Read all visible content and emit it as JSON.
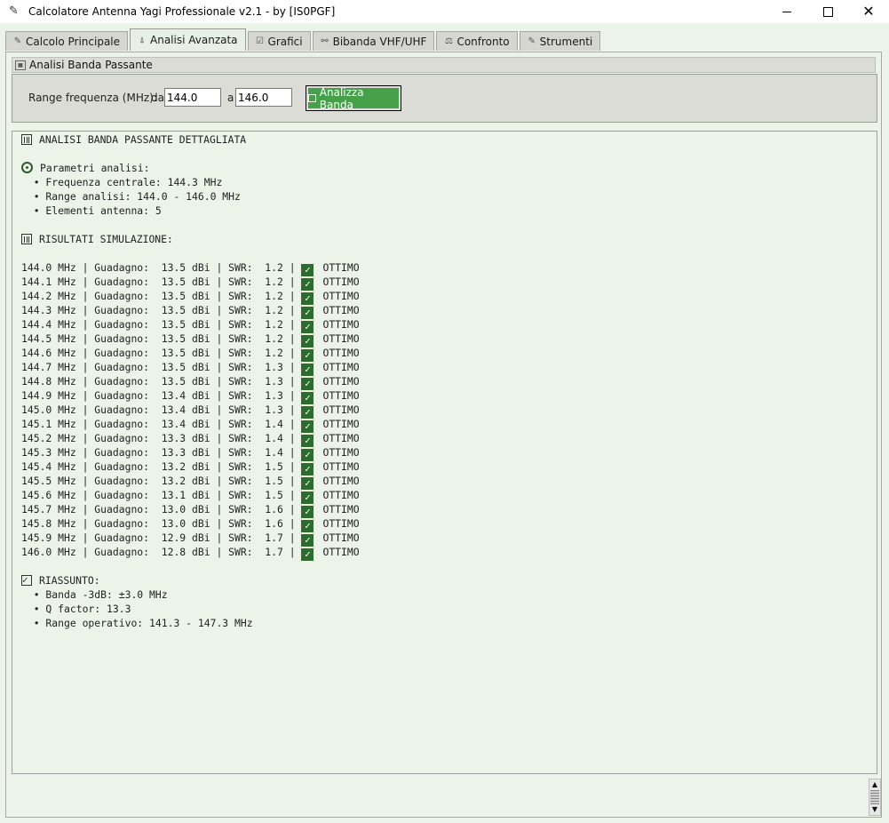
{
  "window": {
    "title": "Calcolatore Antenna Yagi Professionale v2.1 - by [IS0PGF]",
    "minimize_glyph": "",
    "close_glyph": "✕"
  },
  "tabs": [
    {
      "label": "Calcolo Principale",
      "icon": "pencil-icon",
      "active": false
    },
    {
      "label": "Analisi Avanzata",
      "icon": "antenna-icon",
      "active": true
    },
    {
      "label": "Grafici",
      "icon": "checkbox-chart-icon",
      "active": false
    },
    {
      "label": "Bibanda VHF/UHF",
      "icon": "satellite-icon",
      "active": false
    },
    {
      "label": "Confronto",
      "icon": "scales-icon",
      "active": false
    },
    {
      "label": "Strumenti",
      "icon": "wrench-icon",
      "active": false
    }
  ],
  "bandpass": {
    "section_title": "Analisi Banda Passante",
    "range_label": "Range frequenza (MHz):",
    "from_label": "da",
    "from_value": "144.0",
    "to_label": "a",
    "to_value": "146.0",
    "analyze_button": "Analizza Banda"
  },
  "report": {
    "heading": "ANALISI BANDA PASSANTE DETTAGLIATA",
    "params_heading": "Parametri analisi:",
    "params": [
      "  • Frequenza centrale: 144.3 MHz",
      "  • Range analisi: 144.0 - 146.0 MHz",
      "  • Elementi antenna: 5"
    ],
    "results_heading": "RISULTATI SIMULAZIONE:",
    "rows": [
      {
        "freq": "144.0",
        "gain": "13.5",
        "swr": "1.2",
        "status": "OTTIMO"
      },
      {
        "freq": "144.1",
        "gain": "13.5",
        "swr": "1.2",
        "status": "OTTIMO"
      },
      {
        "freq": "144.2",
        "gain": "13.5",
        "swr": "1.2",
        "status": "OTTIMO"
      },
      {
        "freq": "144.3",
        "gain": "13.5",
        "swr": "1.2",
        "status": "OTTIMO"
      },
      {
        "freq": "144.4",
        "gain": "13.5",
        "swr": "1.2",
        "status": "OTTIMO"
      },
      {
        "freq": "144.5",
        "gain": "13.5",
        "swr": "1.2",
        "status": "OTTIMO"
      },
      {
        "freq": "144.6",
        "gain": "13.5",
        "swr": "1.2",
        "status": "OTTIMO"
      },
      {
        "freq": "144.7",
        "gain": "13.5",
        "swr": "1.3",
        "status": "OTTIMO"
      },
      {
        "freq": "144.8",
        "gain": "13.5",
        "swr": "1.3",
        "status": "OTTIMO"
      },
      {
        "freq": "144.9",
        "gain": "13.4",
        "swr": "1.3",
        "status": "OTTIMO"
      },
      {
        "freq": "145.0",
        "gain": "13.4",
        "swr": "1.3",
        "status": "OTTIMO"
      },
      {
        "freq": "145.1",
        "gain": "13.4",
        "swr": "1.4",
        "status": "OTTIMO"
      },
      {
        "freq": "145.2",
        "gain": "13.3",
        "swr": "1.4",
        "status": "OTTIMO"
      },
      {
        "freq": "145.3",
        "gain": "13.3",
        "swr": "1.4",
        "status": "OTTIMO"
      },
      {
        "freq": "145.4",
        "gain": "13.2",
        "swr": "1.5",
        "status": "OTTIMO"
      },
      {
        "freq": "145.5",
        "gain": "13.2",
        "swr": "1.5",
        "status": "OTTIMO"
      },
      {
        "freq": "145.6",
        "gain": "13.1",
        "swr": "1.5",
        "status": "OTTIMO"
      },
      {
        "freq": "145.7",
        "gain": "13.0",
        "swr": "1.6",
        "status": "OTTIMO"
      },
      {
        "freq": "145.8",
        "gain": "13.0",
        "swr": "1.6",
        "status": "OTTIMO"
      },
      {
        "freq": "145.9",
        "gain": "12.9",
        "swr": "1.7",
        "status": "OTTIMO"
      },
      {
        "freq": "146.0",
        "gain": "12.8",
        "swr": "1.7",
        "status": "OTTIMO"
      }
    ],
    "row_labels": {
      "unit": "MHz",
      "gain": "Guadagno:",
      "gain_unit": "dBi",
      "swr": "SWR:"
    },
    "summary_heading": "RIASSUNTO:",
    "summary": [
      "  • Banda -3dB: ±3.0 MHz",
      "  • Q factor: 13.3",
      "  • Range operativo: 141.3 - 147.3 MHz"
    ]
  },
  "colors": {
    "background": "#ecf4ea",
    "accent_green": "#45a049",
    "ok_badge": "#2e6b2e"
  }
}
